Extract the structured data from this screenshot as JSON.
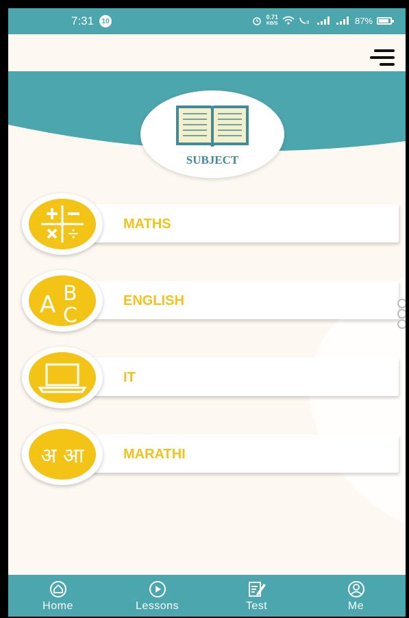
{
  "status_bar": {
    "time": "7:31",
    "notification_count": "10",
    "net_speed_value": "0.71",
    "net_speed_unit": "KB/S",
    "battery": "87%"
  },
  "header": {
    "menu_icon": "hamburger-icon"
  },
  "hero": {
    "title": "SUBJECT",
    "icon": "open-book-icon"
  },
  "subjects": [
    {
      "label": "MATHS",
      "icon": "math-operators-icon"
    },
    {
      "label": "ENGLISH",
      "icon": "abc-letters-icon"
    },
    {
      "label": "IT",
      "icon": "laptop-icon"
    },
    {
      "label": "MARATHI",
      "icon": "devanagari-letters-icon",
      "icon_text": "अ आ"
    }
  ],
  "bottom_nav": [
    {
      "label": "Home",
      "icon": "home-icon"
    },
    {
      "label": "Lessons",
      "icon": "play-icon"
    },
    {
      "label": "Test",
      "icon": "edit-document-icon"
    },
    {
      "label": "Me",
      "icon": "user-icon"
    }
  ],
  "colors": {
    "teal": "#4ca6ad",
    "background": "#fdf8f1",
    "accent_yellow": "#f2c21b"
  }
}
